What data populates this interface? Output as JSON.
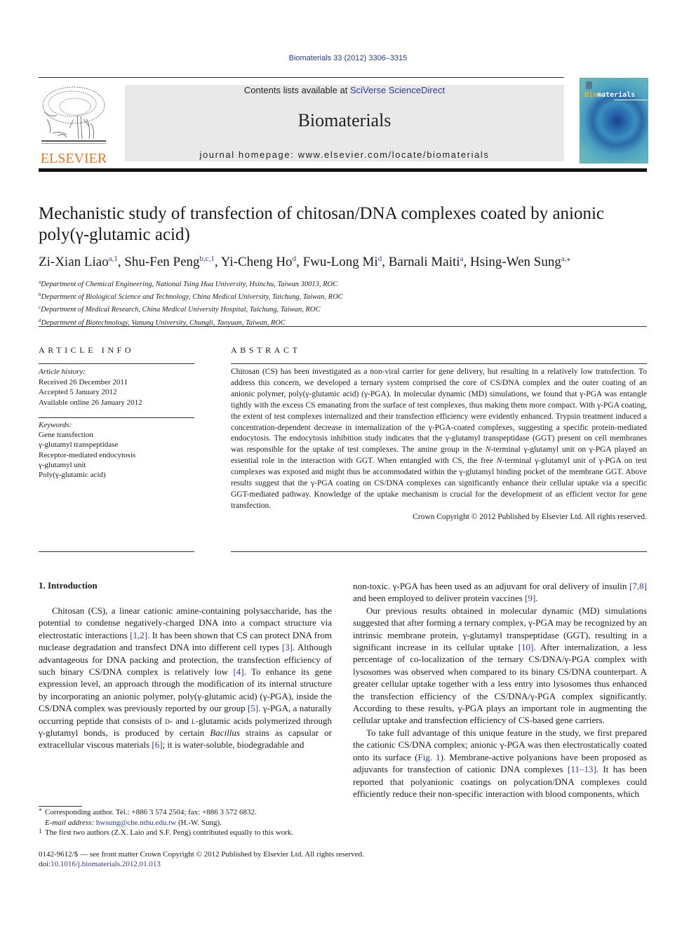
{
  "header": {
    "journal_ref": "Biomaterials 33 (2012) 3306–3315",
    "contents_prefix": "Contents lists available at ",
    "contents_link": "SciVerse ScienceDirect",
    "journal_title": "Biomaterials",
    "homepage": "journal homepage: www.elsevier.com/locate/biomaterials",
    "publisher_logo_text": "ELSEVIER",
    "cover_title_accent": "Bio",
    "cover_title_rest": "materials",
    "colors": {
      "link": "#2b3a8f",
      "elsevier_orange": "#e87722",
      "banner_bg": "#e9e9e9",
      "cover_accent": "#f2b21b"
    }
  },
  "article": {
    "title": "Mechanistic study of transfection of chitosan/DNA complexes coated by anionic poly(γ-glutamic acid)",
    "authors": [
      {
        "name": "Zi-Xian Liao",
        "sup": "a,1"
      },
      {
        "name": "Shu-Fen Peng",
        "sup": "b,c,1"
      },
      {
        "name": "Yi-Cheng Ho",
        "sup": "d"
      },
      {
        "name": "Fwu-Long Mi",
        "sup": "d"
      },
      {
        "name": "Barnali Maiti",
        "sup": "a"
      },
      {
        "name": "Hsing-Wen Sung",
        "sup": "a,⁎"
      }
    ],
    "affiliations": [
      {
        "mark": "a",
        "text": "Department of Chemical Engineering, National Tsing Hua University, Hsinchu, Taiwan 30013, ROC"
      },
      {
        "mark": "b",
        "text": "Department of Biological Science and Technology, China Medical University, Taichung, Taiwan, ROC"
      },
      {
        "mark": "c",
        "text": "Department of Medical Research, China Medical University Hospital, Taichung, Taiwan, ROC"
      },
      {
        "mark": "d",
        "text": "Department of Biotechnology, Vanung University, Chungli, Taoyuan, Taiwan, ROC"
      }
    ]
  },
  "article_info": {
    "heading": "ARTICLE INFO",
    "history_label": "Article history:",
    "history": [
      "Received 26 December 2011",
      "Accepted 5 January 2012",
      "Available online 26 January 2012"
    ],
    "keywords_label": "Keywords:",
    "keywords": [
      "Gene transfection",
      "γ-glutamyl transpeptidase",
      "Receptor-mediated endocytosis",
      "γ-glutamyl unit",
      "Poly(γ-glutamic acid)"
    ]
  },
  "abstract": {
    "heading": "ABSTRACT",
    "p1": "Chitosan (CS) has been investigated as a non-viral carrier for gene delivery, but resulting in a relatively low transfection. To address this concern, we developed a ternary system comprised the core of CS/DNA complex and the outer coating of an anionic polymer, poly(γ-glutamic acid) (γ-PGA). In molecular dynamic (MD) simulations, we found that γ-PGA was entangle tightly with the excess CS emanating from the surface of test complexes, thus making them more compact. With γ-PGA coating, the extent of test complexes internalized and their transfection efficiency were evidently enhanced. Trypsin treatment induced a concentration-dependent decrease in internalization of the γ-PGA-coated complexes, suggesting a specific protein-mediated endocytosis. The endocytosis inhibition study indicates that the γ-glutamyl transpeptidase (GGT) present on cell membranes was responsible for the uptake of test complexes. The amine group in the ",
    "p1_it1": "N",
    "p1b": "-terminal γ-glutamyl unit on γ-PGA played an essential role in the interaction with GGT. When entangled with CS, the free ",
    "p1_it2": "N",
    "p1c": "-terminal γ-glutamyl unit of γ-PGA on test complexes was exposed and might thus be accommodated within the γ-glutamyl binding pocket of the membrane GGT. Above results suggest that the γ-PGA coating on CS/DNA complexes can significantly enhance their cellular uptake via a specific GGT-mediated pathway. Knowledge of the uptake mechanism is crucial for the development of an efficient vector for gene transfection.",
    "copyright": "Crown Copyright © 2012 Published by Elsevier Ltd. All rights reserved."
  },
  "intro": {
    "heading": "1.  Introduction",
    "left": {
      "s1": "Chitosan (CS), a linear cationic amine-containing polysaccharide, has the potential to condense negatively-charged DNA into a compact structure via electrostatic interactions ",
      "r1": "[1,2]",
      "s2": ". It has been shown that CS can protect DNA from nuclease degradation and transfect DNA into different cell types ",
      "r2": "[3]",
      "s3": ". Although advantageous for DNA packing and protection, the transfection efficiency of such binary CS/DNA complex is relatively low ",
      "r3": "[4]",
      "s4": ". To enhance its gene expression level, an approach through the modification of its internal structure by incorporating an anionic polymer, poly(γ-glutamic acid) (γ-PGA), inside the CS/DNA complex was previously reported by our group ",
      "r4": "[5]",
      "s5": ". γ-PGA, a naturally occurring peptide that consists of ",
      "sc1": "d",
      "s6": "- and ",
      "sc2": "l",
      "s7": "-glutamic acids polymerized through γ-glutamyl bonds, is produced by certain ",
      "it1": "Bacillus",
      "s8": " strains as capsular or extracellular viscous materials ",
      "r5": "[6]",
      "s9": "; it is water-soluble, biodegradable and"
    },
    "right": {
      "p1a": "non-toxic. γ-PGA has been used as an adjuvant for oral delivery of insulin ",
      "p1r1": "[7,8]",
      "p1b": " and been employed to deliver protein vaccines ",
      "p1r2": "[9]",
      "p1c": ".",
      "p2a": "Our previous results obtained in molecular dynamic (MD) simulations suggested that after forming a ternary complex, γ-PGA may be recognized by an intrinsic membrane protein, γ-glutamyl transpeptidase (GGT), resulting in a significant increase in its cellular uptake ",
      "p2r1": "[10]",
      "p2b": ". After internalization, a less percentage of co-localization of the ternary CS/DNA/γ-PGA complex with lysosomes was observed when compared to its binary CS/DNA counterpart. A greater cellular uptake together with a less entry into lysosomes thus enhanced the transfection efficiency of the CS/DNA/γ-PGA complex significantly. According to these results, γ-PGA plays an important role in augmenting the cellular uptake and transfection efficiency of CS-based gene carriers.",
      "p3a": "To take full advantage of this unique feature in the study, we first prepared the cationic CS/DNA complex; anionic γ-PGA was then electrostatically coated onto its surface (",
      "p3r1": "Fig. 1",
      "p3b": "). Membrane-active polyanions have been proposed as adjuvants for transfection of cationic DNA complexes ",
      "p3r2": "[11–13]",
      "p3c": ". It has been reported that polyanionic coatings on polycation/DNA complexes could efficiently reduce their non-specific interaction with blood components, which"
    }
  },
  "footnotes": {
    "corr_mark": "*",
    "corr": "Corresponding author. Tel.: +886 3 574 2504; fax: +886 3 572 6832.",
    "email_label": "E-mail address:",
    "email": "hwsung@che.nthu.edu.tw",
    "email_suffix": " (H.-W. Sung).",
    "fn1_mark": "1",
    "fn1": "The first two authors (Z.X. Laio and S.F. Peng) contributed equally to this work."
  },
  "bottom": {
    "issn": "0142-9612/$ — see front matter Crown Copyright © 2012 Published by Elsevier Ltd. All rights reserved.",
    "doi_label": "doi:",
    "doi": "10.1016/j.biomaterials.2012.01.013"
  }
}
